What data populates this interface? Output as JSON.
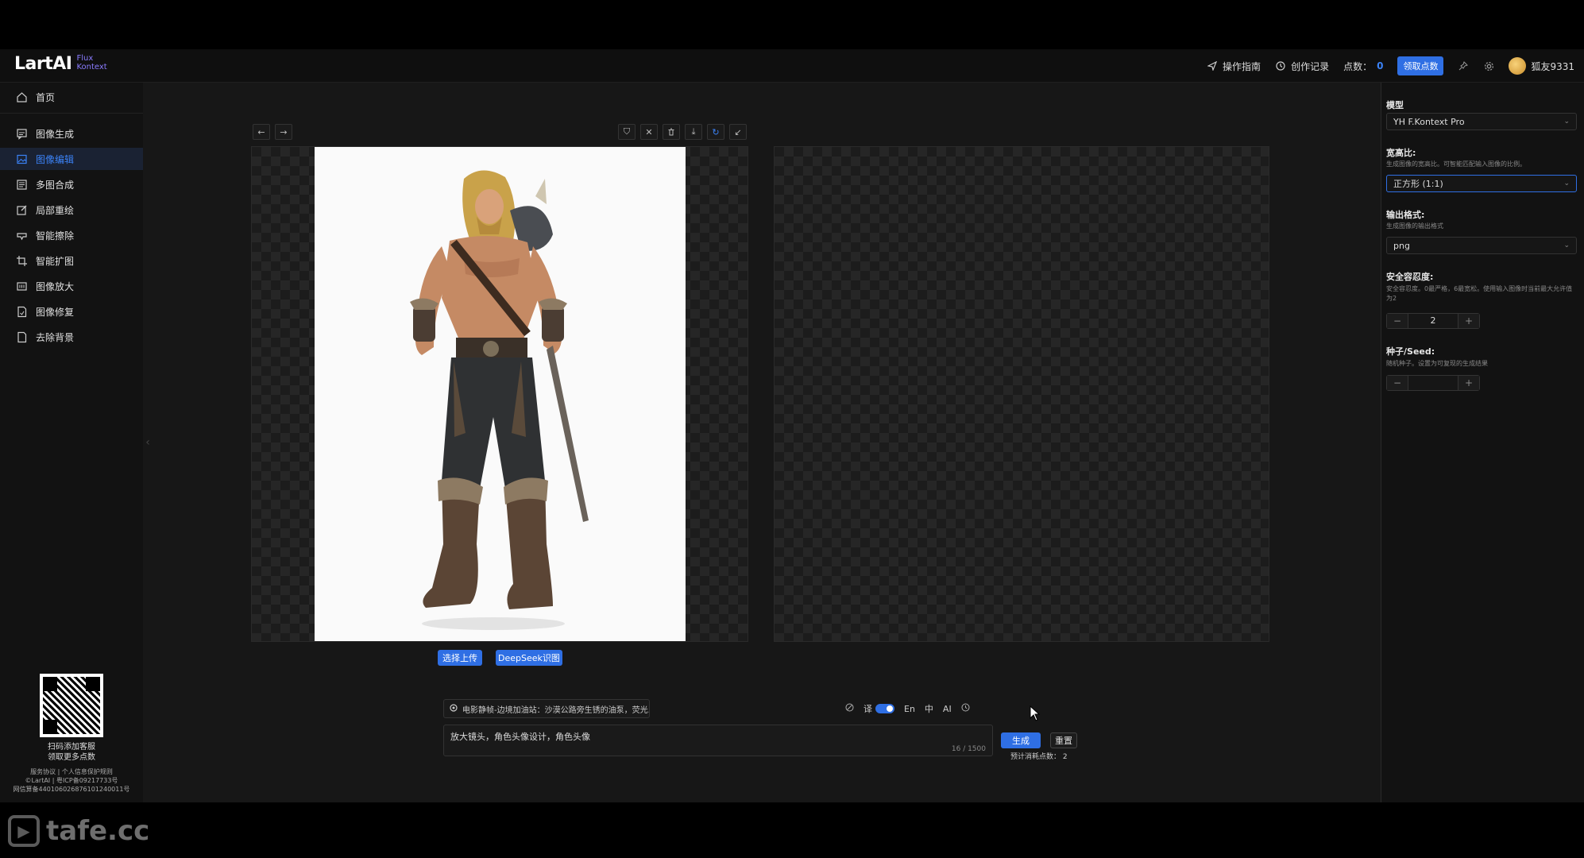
{
  "header": {
    "logo_main": "LartAI",
    "logo_sub_1": "Flux",
    "logo_sub_2": "Kontext",
    "guide": "操作指南",
    "history": "创作记录",
    "points_label": "点数：",
    "points_value": "0",
    "claim_button": "领取点数",
    "username": "狐友9331"
  },
  "sidebar": {
    "items": [
      {
        "label": "首页",
        "icon": "home-icon"
      },
      {
        "label": "图像生成",
        "icon": "chat-image-icon"
      },
      {
        "label": "图像编辑",
        "icon": "image-edit-icon",
        "active": true
      },
      {
        "label": "多图合成",
        "icon": "multi-image-icon"
      },
      {
        "label": "局部重绘",
        "icon": "edit-square-icon"
      },
      {
        "label": "智能擦除",
        "icon": "eraser-icon"
      },
      {
        "label": "智能扩图",
        "icon": "crop-expand-icon"
      },
      {
        "label": "图像放大",
        "icon": "upscale-icon"
      },
      {
        "label": "图像修复",
        "icon": "repair-doc-icon"
      },
      {
        "label": "去除背景",
        "icon": "remove-bg-icon"
      }
    ],
    "qr_caption_1": "扫码添加客服",
    "qr_caption_2": "领取更多点数",
    "footer_1": "服务协议 | 个人信息保护规则",
    "footer_2": "©LartAI | 粤ICP备09217733号",
    "footer_3": "网信算备440106026876101240011号"
  },
  "canvas": {
    "upload_button": "选择上传",
    "deepseek_button": "DeepSeek识图",
    "source_image_description_icon": "viking-warrior-image"
  },
  "prompt": {
    "preset_text": "电影静帧-边境加油站：沙漠公路旁生锈的油泵，荧光...",
    "translate_label": "译",
    "lang_en": "En",
    "lang_zh": "中",
    "ai_label": "AI",
    "text": "放大镜头，角色头像设计，角色头像",
    "char_count": "16 / 1500",
    "generate_button": "生成",
    "reset_button": "重置",
    "cost_label": "预计消耗点数：",
    "cost_value": "2"
  },
  "settings": {
    "model_label": "模型",
    "model_value": "YH F.Kontext Pro",
    "ratio_label": "宽高比:",
    "ratio_desc": "生成图像的宽高比。可智能匹配输入图像的比例。",
    "ratio_value": "正方形 (1:1)",
    "format_label": "输出格式:",
    "format_desc": "生成图像的输出格式",
    "format_value": "png",
    "safety_label": "安全容忍度:",
    "safety_desc": "安全容忍度。0最严格，6最宽松。使用输入图像时当前最大允许值为2",
    "safety_value": "2",
    "seed_label": "种子/Seed:",
    "seed_desc": "随机种子。设置为可复现的生成结果",
    "seed_value": ""
  },
  "watermark": "tafe.cc",
  "colors": {
    "accent": "#2f6fe4",
    "background": "#171717",
    "sidebar": "#121212"
  }
}
